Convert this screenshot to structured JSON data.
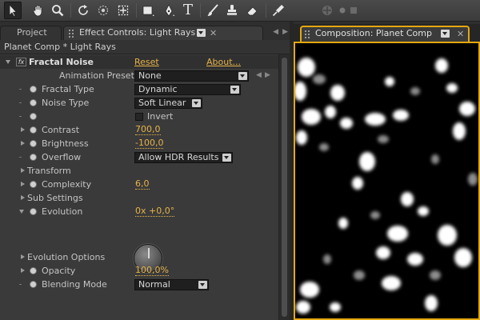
{
  "toolbar": {
    "tools": [
      "selection-tool",
      "hand-tool",
      "zoom-tool",
      "rotation-tool",
      "orbit-camera-tool",
      "pan-behind-tool",
      "rectangle-tool",
      "pen-tool",
      "type-tool",
      "brush-tool",
      "clone-stamp-tool",
      "eraser-tool",
      "puppet-pin-tool"
    ],
    "type_tool_glyph": "T"
  },
  "left_panel": {
    "tabs": {
      "project": "Project",
      "effect_controls": "Effect Controls: Light Rays"
    },
    "layer_path": "Planet Comp * Light Rays",
    "effect": {
      "name": "Fractal Noise",
      "reset": "Reset",
      "about": "About...",
      "fx_badge": "fx"
    },
    "props": {
      "animation_presets": {
        "label": "Animation Presets:",
        "value": "None"
      },
      "fractal_type": {
        "label": "Fractal Type",
        "value": "Dynamic"
      },
      "noise_type": {
        "label": "Noise Type",
        "value": "Soft Linear"
      },
      "invert": {
        "label": "Invert"
      },
      "contrast": {
        "label": "Contrast",
        "value": "700,0"
      },
      "brightness": {
        "label": "Brightness",
        "value": "-100,0"
      },
      "overflow": {
        "label": "Overflow",
        "value": "Allow HDR Results"
      },
      "transform": {
        "label": "Transform"
      },
      "complexity": {
        "label": "Complexity",
        "value": "6,0"
      },
      "sub_settings": {
        "label": "Sub Settings"
      },
      "evolution": {
        "label": "Evolution",
        "value": "0x +0,0°"
      },
      "evolution_options": {
        "label": "Evolution Options"
      },
      "opacity": {
        "label": "Opacity",
        "value": "100,0%"
      },
      "blending_mode": {
        "label": "Blending Mode",
        "value": "Normal"
      }
    }
  },
  "right_panel": {
    "tab": "Composition: Planet Comp"
  },
  "colors": {
    "accent": "#e5a80f",
    "value_orange": "#e6b34a",
    "panel_bg": "#3a3a3a"
  }
}
